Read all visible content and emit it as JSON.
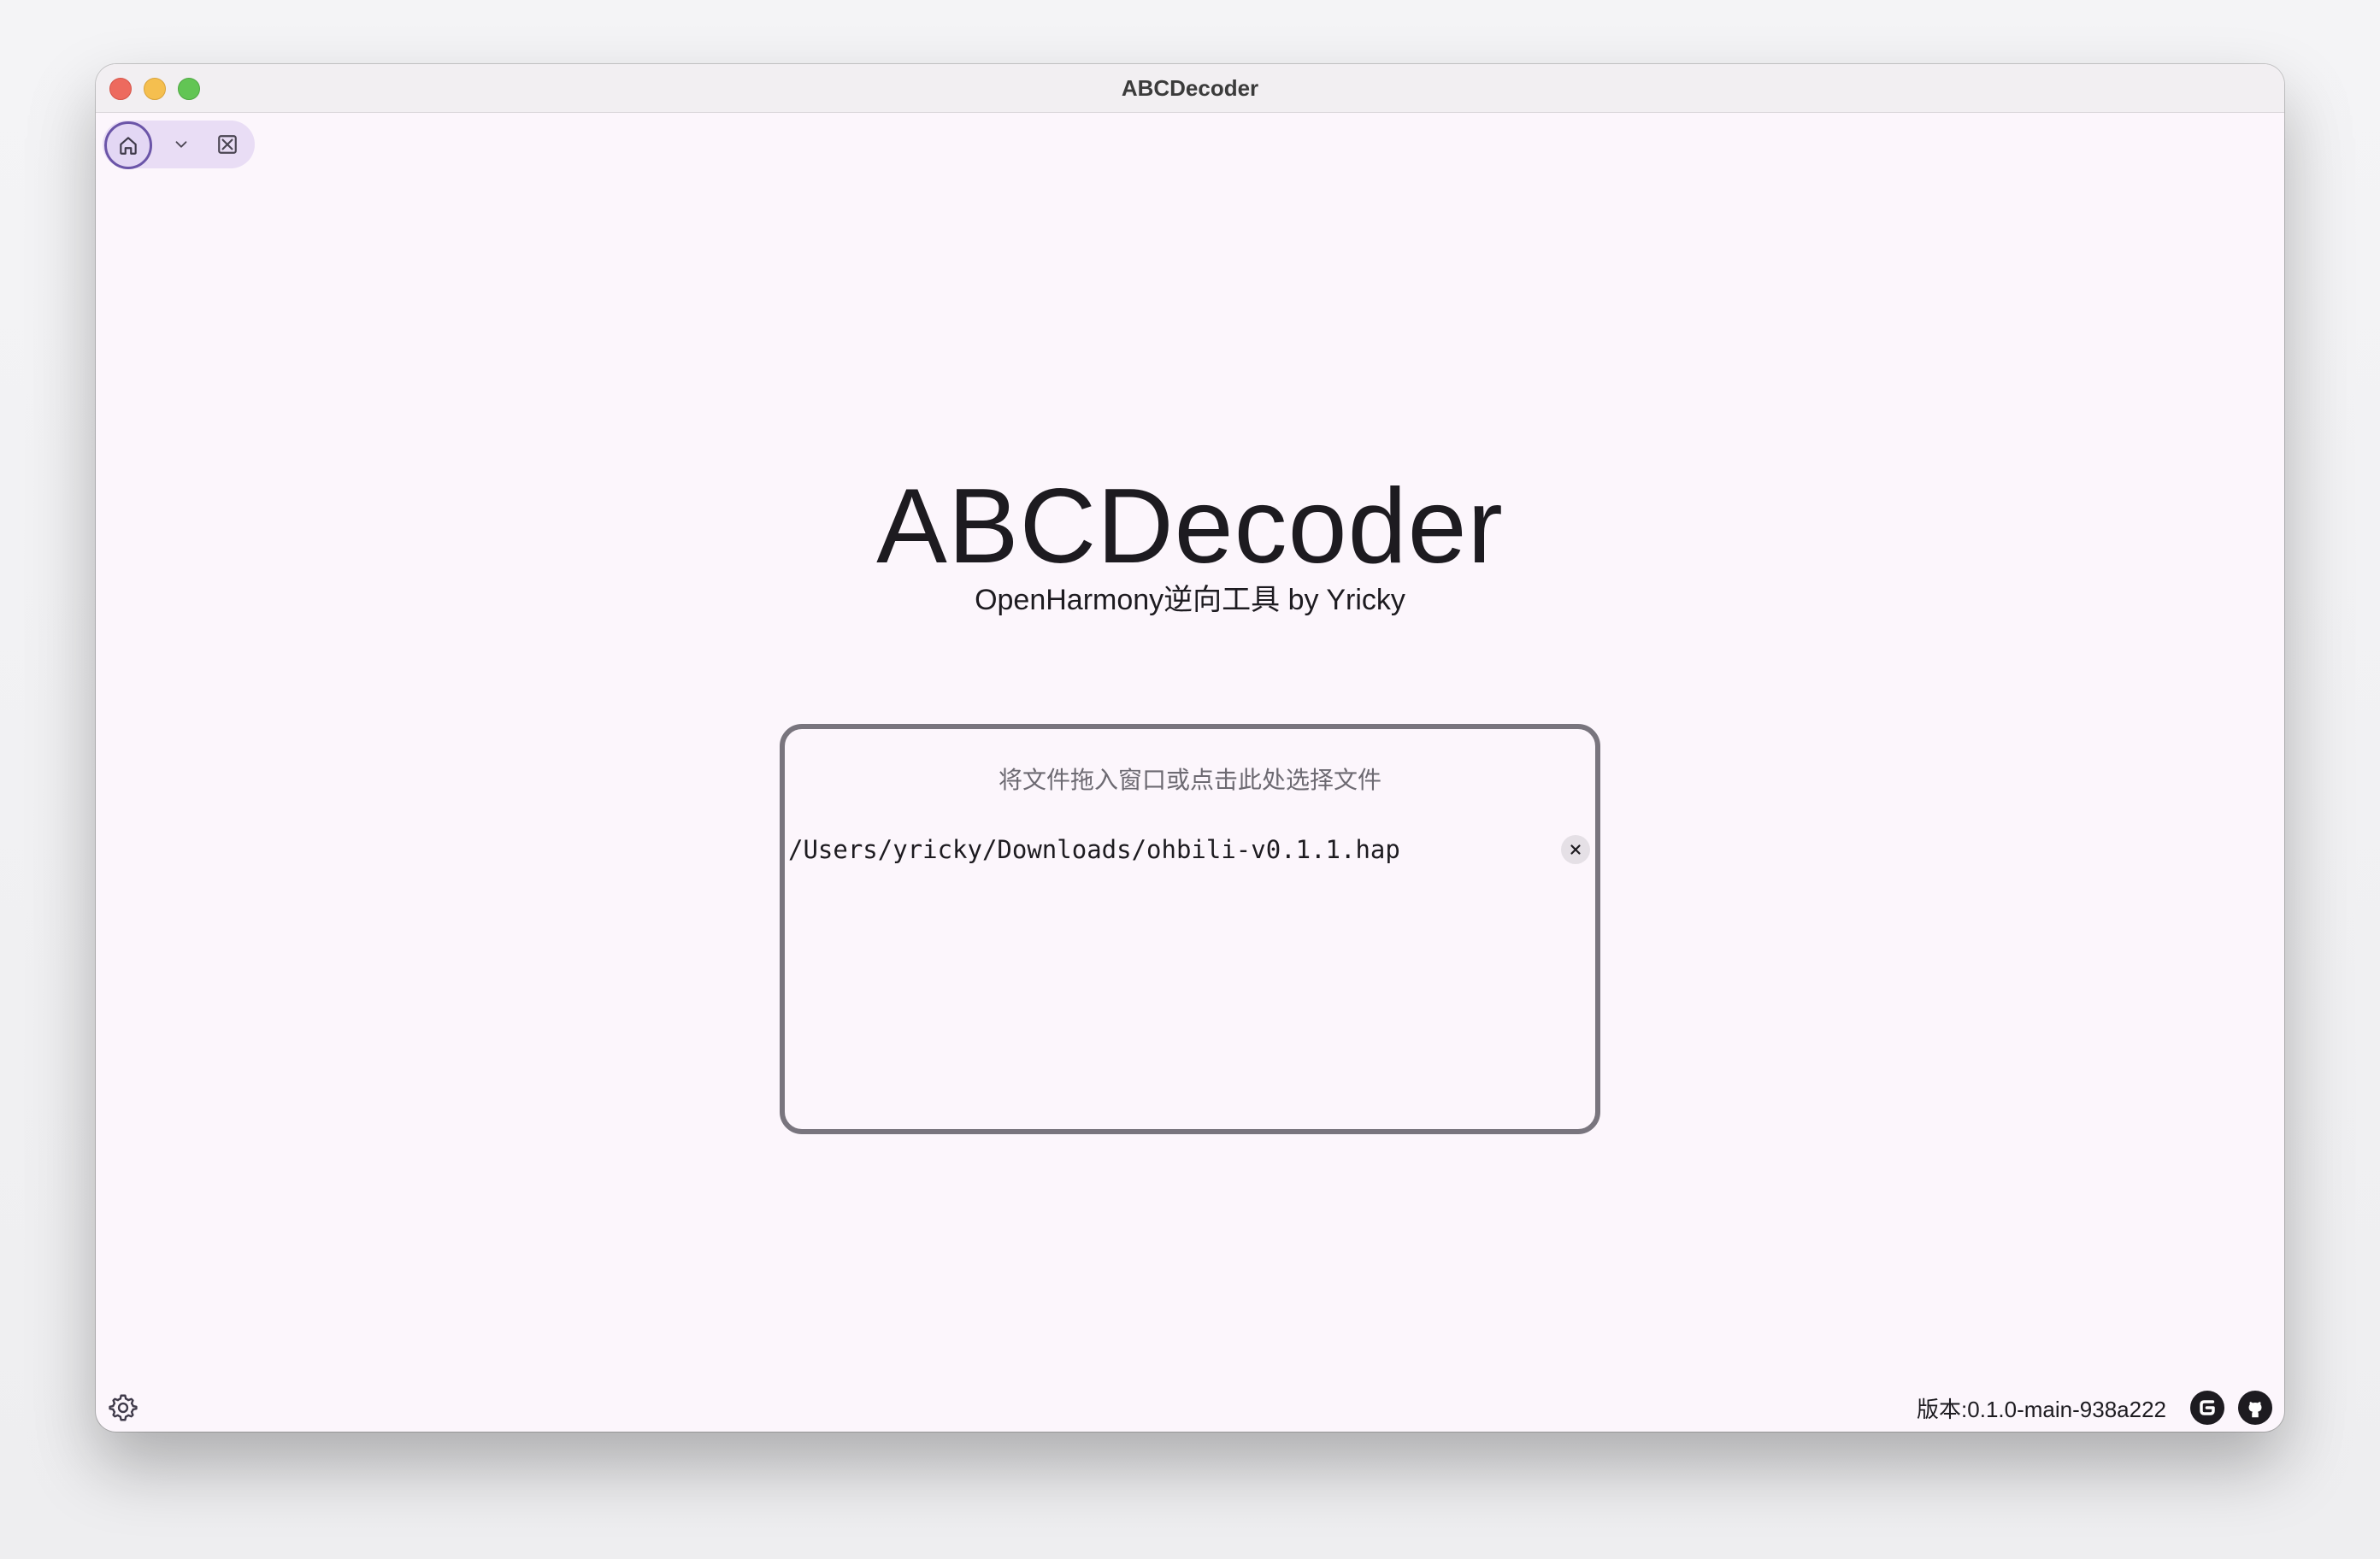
{
  "window": {
    "title": "ABCDecoder"
  },
  "tabs": {
    "home_icon": "home-icon",
    "expand_icon": "chevron-down-icon",
    "close_all_icon": "close-all-icon"
  },
  "main": {
    "title": "ABCDecoder",
    "subtitle": "OpenHarmony逆向工具 by Yricky"
  },
  "dropzone": {
    "hint": "将文件拖入窗口或点击此处选择文件",
    "files": [
      {
        "path": "/Users/yricky/Downloads/ohbili-v0.1.1.hap"
      }
    ]
  },
  "footer": {
    "settings_icon": "gear-icon",
    "version": "版本:0.1.0-main-938a222",
    "links": [
      "gitee-icon",
      "github-icon"
    ]
  },
  "colors": {
    "background": "#fcf6fc",
    "accent": "#6b55a8",
    "tab_bar": "#e9ddf5",
    "dropzone_border": "#79757e",
    "text": "#1d1b20"
  }
}
